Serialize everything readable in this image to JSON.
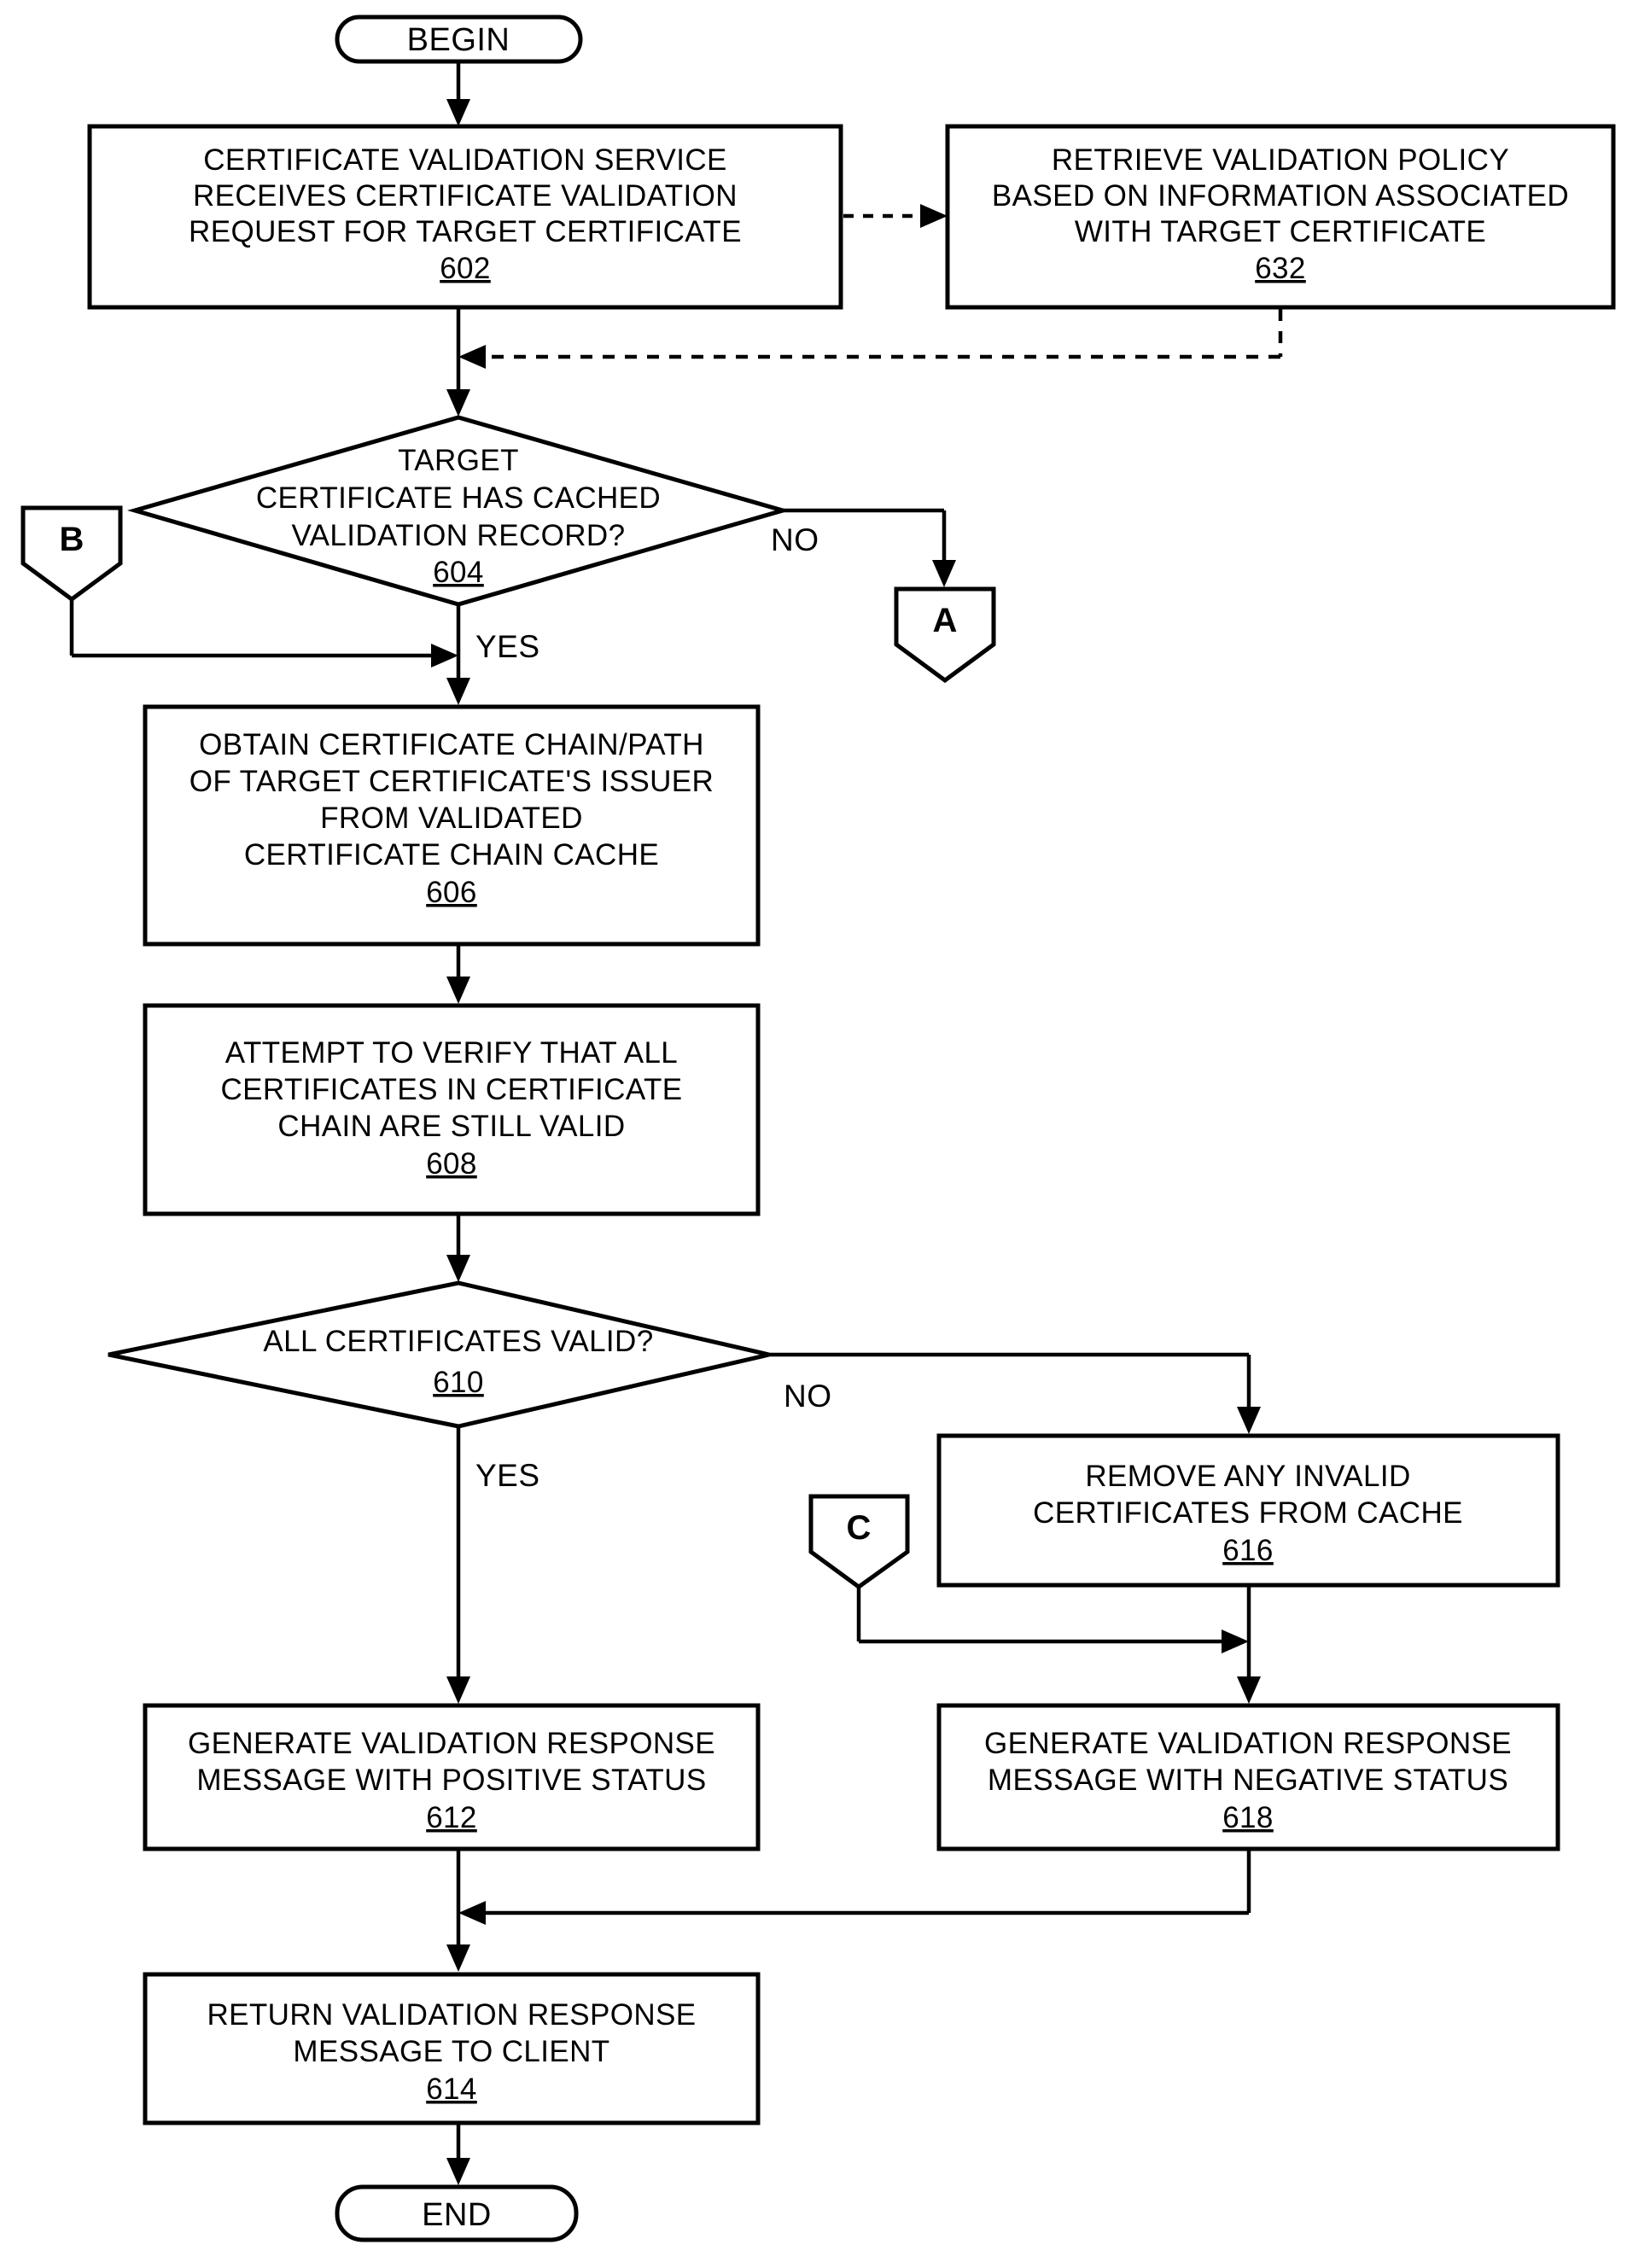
{
  "diagram": {
    "type": "flowchart",
    "title": "Certificate validation service cached-record flow",
    "terminals": {
      "begin": "BEGIN",
      "end": "END"
    },
    "off_page_connectors": [
      {
        "id": "B",
        "label": "B"
      },
      {
        "id": "A",
        "label": "A"
      },
      {
        "id": "C",
        "label": "C"
      }
    ],
    "edge_labels": {
      "d604_no": "NO",
      "d604_yes": "YES",
      "d610_no": "NO",
      "d610_yes": "YES"
    },
    "nodes": [
      {
        "id": "n602",
        "shape": "process",
        "ref": "602",
        "lines": [
          "CERTIFICATE VALIDATION SERVICE",
          "RECEIVES CERTIFICATE VALIDATION",
          "REQUEST FOR TARGET CERTIFICATE"
        ]
      },
      {
        "id": "n632",
        "shape": "process",
        "ref": "632",
        "lines": [
          "RETRIEVE VALIDATION POLICY",
          "BASED ON INFORMATION ASSOCIATED",
          "WITH TARGET CERTIFICATE"
        ]
      },
      {
        "id": "n604",
        "shape": "decision",
        "ref": "604",
        "lines": [
          "TARGET",
          "CERTIFICATE HAS CACHED",
          "VALIDATION RECORD?"
        ]
      },
      {
        "id": "n606",
        "shape": "process",
        "ref": "606",
        "lines": [
          "OBTAIN CERTIFICATE CHAIN/PATH",
          "OF TARGET CERTIFICATE'S ISSUER",
          "FROM VALIDATED",
          "CERTIFICATE CHAIN CACHE"
        ]
      },
      {
        "id": "n608",
        "shape": "process",
        "ref": "608",
        "lines": [
          "ATTEMPT TO VERIFY THAT ALL",
          "CERTIFICATES IN CERTIFICATE",
          "CHAIN ARE STILL VALID"
        ]
      },
      {
        "id": "n610",
        "shape": "decision",
        "ref": "610",
        "lines": [
          "ALL CERTIFICATES VALID?"
        ]
      },
      {
        "id": "n616",
        "shape": "process",
        "ref": "616",
        "lines": [
          "REMOVE ANY INVALID",
          "CERTIFICATES FROM CACHE"
        ]
      },
      {
        "id": "n612",
        "shape": "process",
        "ref": "612",
        "lines": [
          "GENERATE VALIDATION RESPONSE",
          "MESSAGE WITH POSITIVE STATUS"
        ]
      },
      {
        "id": "n618",
        "shape": "process",
        "ref": "618",
        "lines": [
          "GENERATE VALIDATION RESPONSE",
          "MESSAGE WITH NEGATIVE STATUS"
        ]
      },
      {
        "id": "n614",
        "shape": "process",
        "ref": "614",
        "lines": [
          "RETURN VALIDATION RESPONSE",
          "MESSAGE TO CLIENT"
        ]
      }
    ],
    "text": {
      "n602_l1": "CERTIFICATE VALIDATION SERVICE",
      "n602_l2": "RECEIVES CERTIFICATE VALIDATION",
      "n602_l3": "REQUEST FOR TARGET CERTIFICATE",
      "n602_ref": "602",
      "n632_l1": "RETRIEVE VALIDATION POLICY",
      "n632_l2": "BASED ON INFORMATION ASSOCIATED",
      "n632_l3": "WITH TARGET CERTIFICATE",
      "n632_ref": "632",
      "n604_l1": "TARGET",
      "n604_l2": "CERTIFICATE HAS CACHED",
      "n604_l3": "VALIDATION RECORD?",
      "n604_ref": "604",
      "n606_l1": "OBTAIN CERTIFICATE CHAIN/PATH",
      "n606_l2": "OF TARGET CERTIFICATE'S ISSUER",
      "n606_l3": "FROM VALIDATED",
      "n606_l4": "CERTIFICATE CHAIN CACHE",
      "n606_ref": "606",
      "n608_l1": "ATTEMPT TO VERIFY THAT ALL",
      "n608_l2": "CERTIFICATES IN CERTIFICATE",
      "n608_l3": "CHAIN ARE STILL VALID",
      "n608_ref": "608",
      "n610_l1": "ALL CERTIFICATES VALID?",
      "n610_ref": "610",
      "n616_l1": "REMOVE ANY INVALID",
      "n616_l2": "CERTIFICATES FROM CACHE",
      "n616_ref": "616",
      "n612_l1": "GENERATE VALIDATION RESPONSE",
      "n612_l2": "MESSAGE WITH POSITIVE STATUS",
      "n612_ref": "612",
      "n618_l1": "GENERATE VALIDATION RESPONSE",
      "n618_l2": "MESSAGE WITH NEGATIVE STATUS",
      "n618_ref": "618",
      "n614_l1": "RETURN VALIDATION RESPONSE",
      "n614_l2": "MESSAGE TO CLIENT",
      "n614_ref": "614",
      "begin": "BEGIN",
      "end": "END",
      "conn_a": "A",
      "conn_b": "B",
      "conn_c": "C",
      "no_604": "NO",
      "yes_604": "YES",
      "no_610": "NO",
      "yes_610": "YES"
    },
    "colors": {
      "stroke": "#000000",
      "background": "#ffffff",
      "text": "#000000"
    }
  }
}
